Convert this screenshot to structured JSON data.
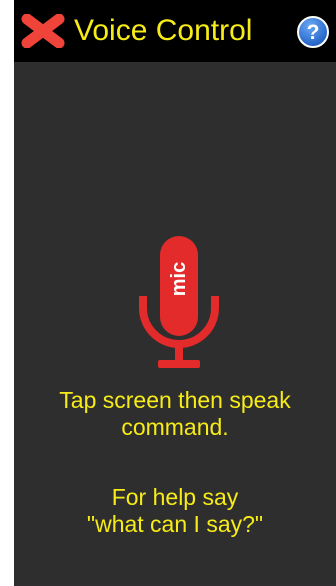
{
  "header": {
    "title": "Voice Control",
    "close_icon": "close-x-icon",
    "help_icon": "help-question-icon"
  },
  "mic": {
    "label": "mic",
    "icon": "microphone-icon"
  },
  "instructions": {
    "line1": "Tap screen then speak",
    "line2": "command.",
    "line3": "For help say",
    "line4": "\"what can I say?\""
  },
  "colors": {
    "accent_yellow": "#f7ec17",
    "mic_red": "#e32b2b",
    "close_red": "#f0443a",
    "help_blue": "#2f75d6",
    "background": "#2e2e2e",
    "header_bg": "#000000"
  }
}
